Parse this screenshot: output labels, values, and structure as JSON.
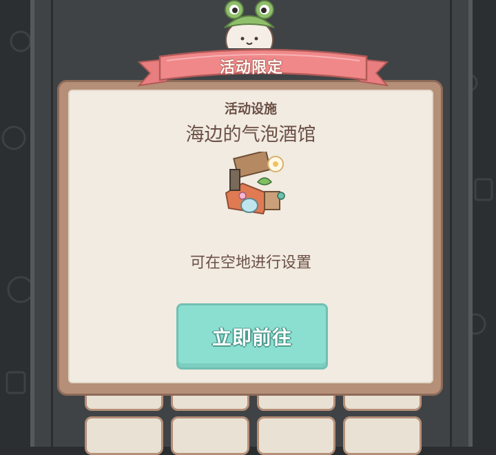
{
  "dialog": {
    "banner": "活动限定",
    "category": "活动设施",
    "item_name": "海边的气泡酒馆",
    "hint": "可在空地进行设置",
    "action_button": "立即前往"
  },
  "icons": {
    "mascot": "frog-hat-rabbit-mascot",
    "item_image": "bubble-tavern-facility-thumbnail"
  },
  "colors": {
    "ribbon": "#f0888a",
    "panel": "#f1ebe1",
    "frame": "#b58f78",
    "button": "#8bdfd0",
    "text": "#6b4f45"
  }
}
